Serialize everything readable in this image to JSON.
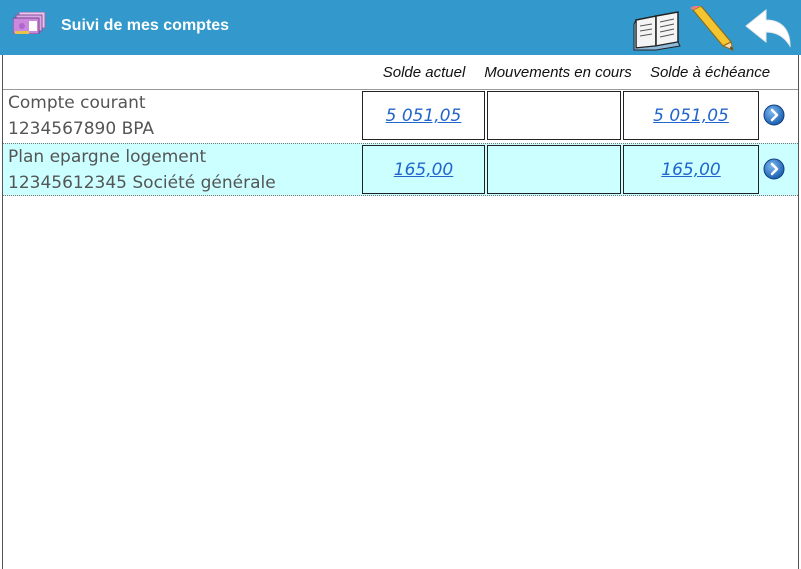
{
  "header": {
    "title": "Suivi de mes comptes",
    "icons": {
      "app": "euro-banknotes-icon",
      "book": "open-book-icon",
      "pencil": "pencil-icon",
      "back": "back-arrow-icon"
    },
    "background_color": "#3399cc"
  },
  "table": {
    "columns": [
      "Solde actuel",
      "Mouvements en cours",
      "Solde à échéance"
    ],
    "rows": [
      {
        "account_name": "Compte courant",
        "account_number": "1234567890 BPA",
        "solde_actuel": "5 051,05",
        "mouvements_en_cours": "",
        "solde_echeance": "5 051,05",
        "highlighted": false
      },
      {
        "account_name": "Plan epargne logement",
        "account_number": "12345612345 Société générale",
        "solde_actuel": "165,00",
        "mouvements_en_cours": "",
        "solde_echeance": "165,00",
        "highlighted": true
      }
    ],
    "row_action_icon": "chevron-right-circle-icon",
    "highlight_color": "#ccffff",
    "link_color": "#2266cc"
  }
}
